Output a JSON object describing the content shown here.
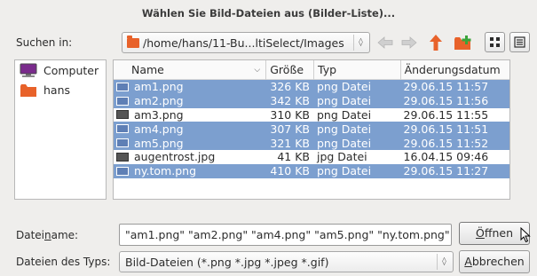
{
  "dialog": {
    "title": "Wählen Sie Bild-Dateien aus (Bilder-Liste)..."
  },
  "lookin": {
    "label": "Suchen in:",
    "path": "/home/hans/11-Bu...ltiSelect/Images"
  },
  "toolbar": {
    "icons": [
      "back-arrow-icon",
      "forward-arrow-icon",
      "up-arrow-icon",
      "new-folder-icon",
      "icon-view-icon",
      "list-view-icon"
    ],
    "colors": {
      "up_arrow": "#e8622a",
      "new_folder": "#e8622a",
      "plus": "#3aa43a"
    }
  },
  "sidebar": {
    "items": [
      {
        "label": "Computer",
        "icon": "computer-icon"
      },
      {
        "label": "hans",
        "icon": "folder-icon"
      }
    ]
  },
  "filelist": {
    "headers": {
      "name": "Name",
      "size": "Größe",
      "type": "Typ",
      "date": "Änderungsdatum"
    },
    "rows": [
      {
        "name": "am1.png",
        "size": "326 KB",
        "type": "png Datei",
        "date": "29.06.15 11:57",
        "selected": true
      },
      {
        "name": "am2.png",
        "size": "342 KB",
        "type": "png Datei",
        "date": "29.06.15 11:56",
        "selected": true
      },
      {
        "name": "am3.png",
        "size": "310 KB",
        "type": "png Datei",
        "date": "29.06.15 11:55",
        "selected": false
      },
      {
        "name": "am4.png",
        "size": "307 KB",
        "type": "png Datei",
        "date": "29.06.15 11:51",
        "selected": true
      },
      {
        "name": "am5.png",
        "size": "321 KB",
        "type": "png Datei",
        "date": "29.06.15 11:52",
        "selected": true
      },
      {
        "name": "augentrost.jpg",
        "size": "41 KB",
        "type": "jpg Datei",
        "date": "16.04.15 09:46",
        "selected": false
      },
      {
        "name": "ny.tom.png",
        "size": "410 KB",
        "type": "png Datei",
        "date": "29.06.15 11:27",
        "selected": true
      }
    ],
    "selection_color": "#7c9fcf"
  },
  "filename": {
    "label_pre": "Datei",
    "label_u": "n",
    "label_post": "ame:",
    "value": "\"am1.png\" \"am2.png\" \"am4.png\" \"am5.png\" \"ny.tom.png\""
  },
  "filetype": {
    "label": "Dateien des Typs:",
    "value": "Bild-Dateien (*.png *.jpg *.jpeg *.gif)"
  },
  "buttons": {
    "open_u": "Ö",
    "open_rest": "ffnen",
    "cancel_u": "A",
    "cancel_rest": "bbrechen"
  }
}
